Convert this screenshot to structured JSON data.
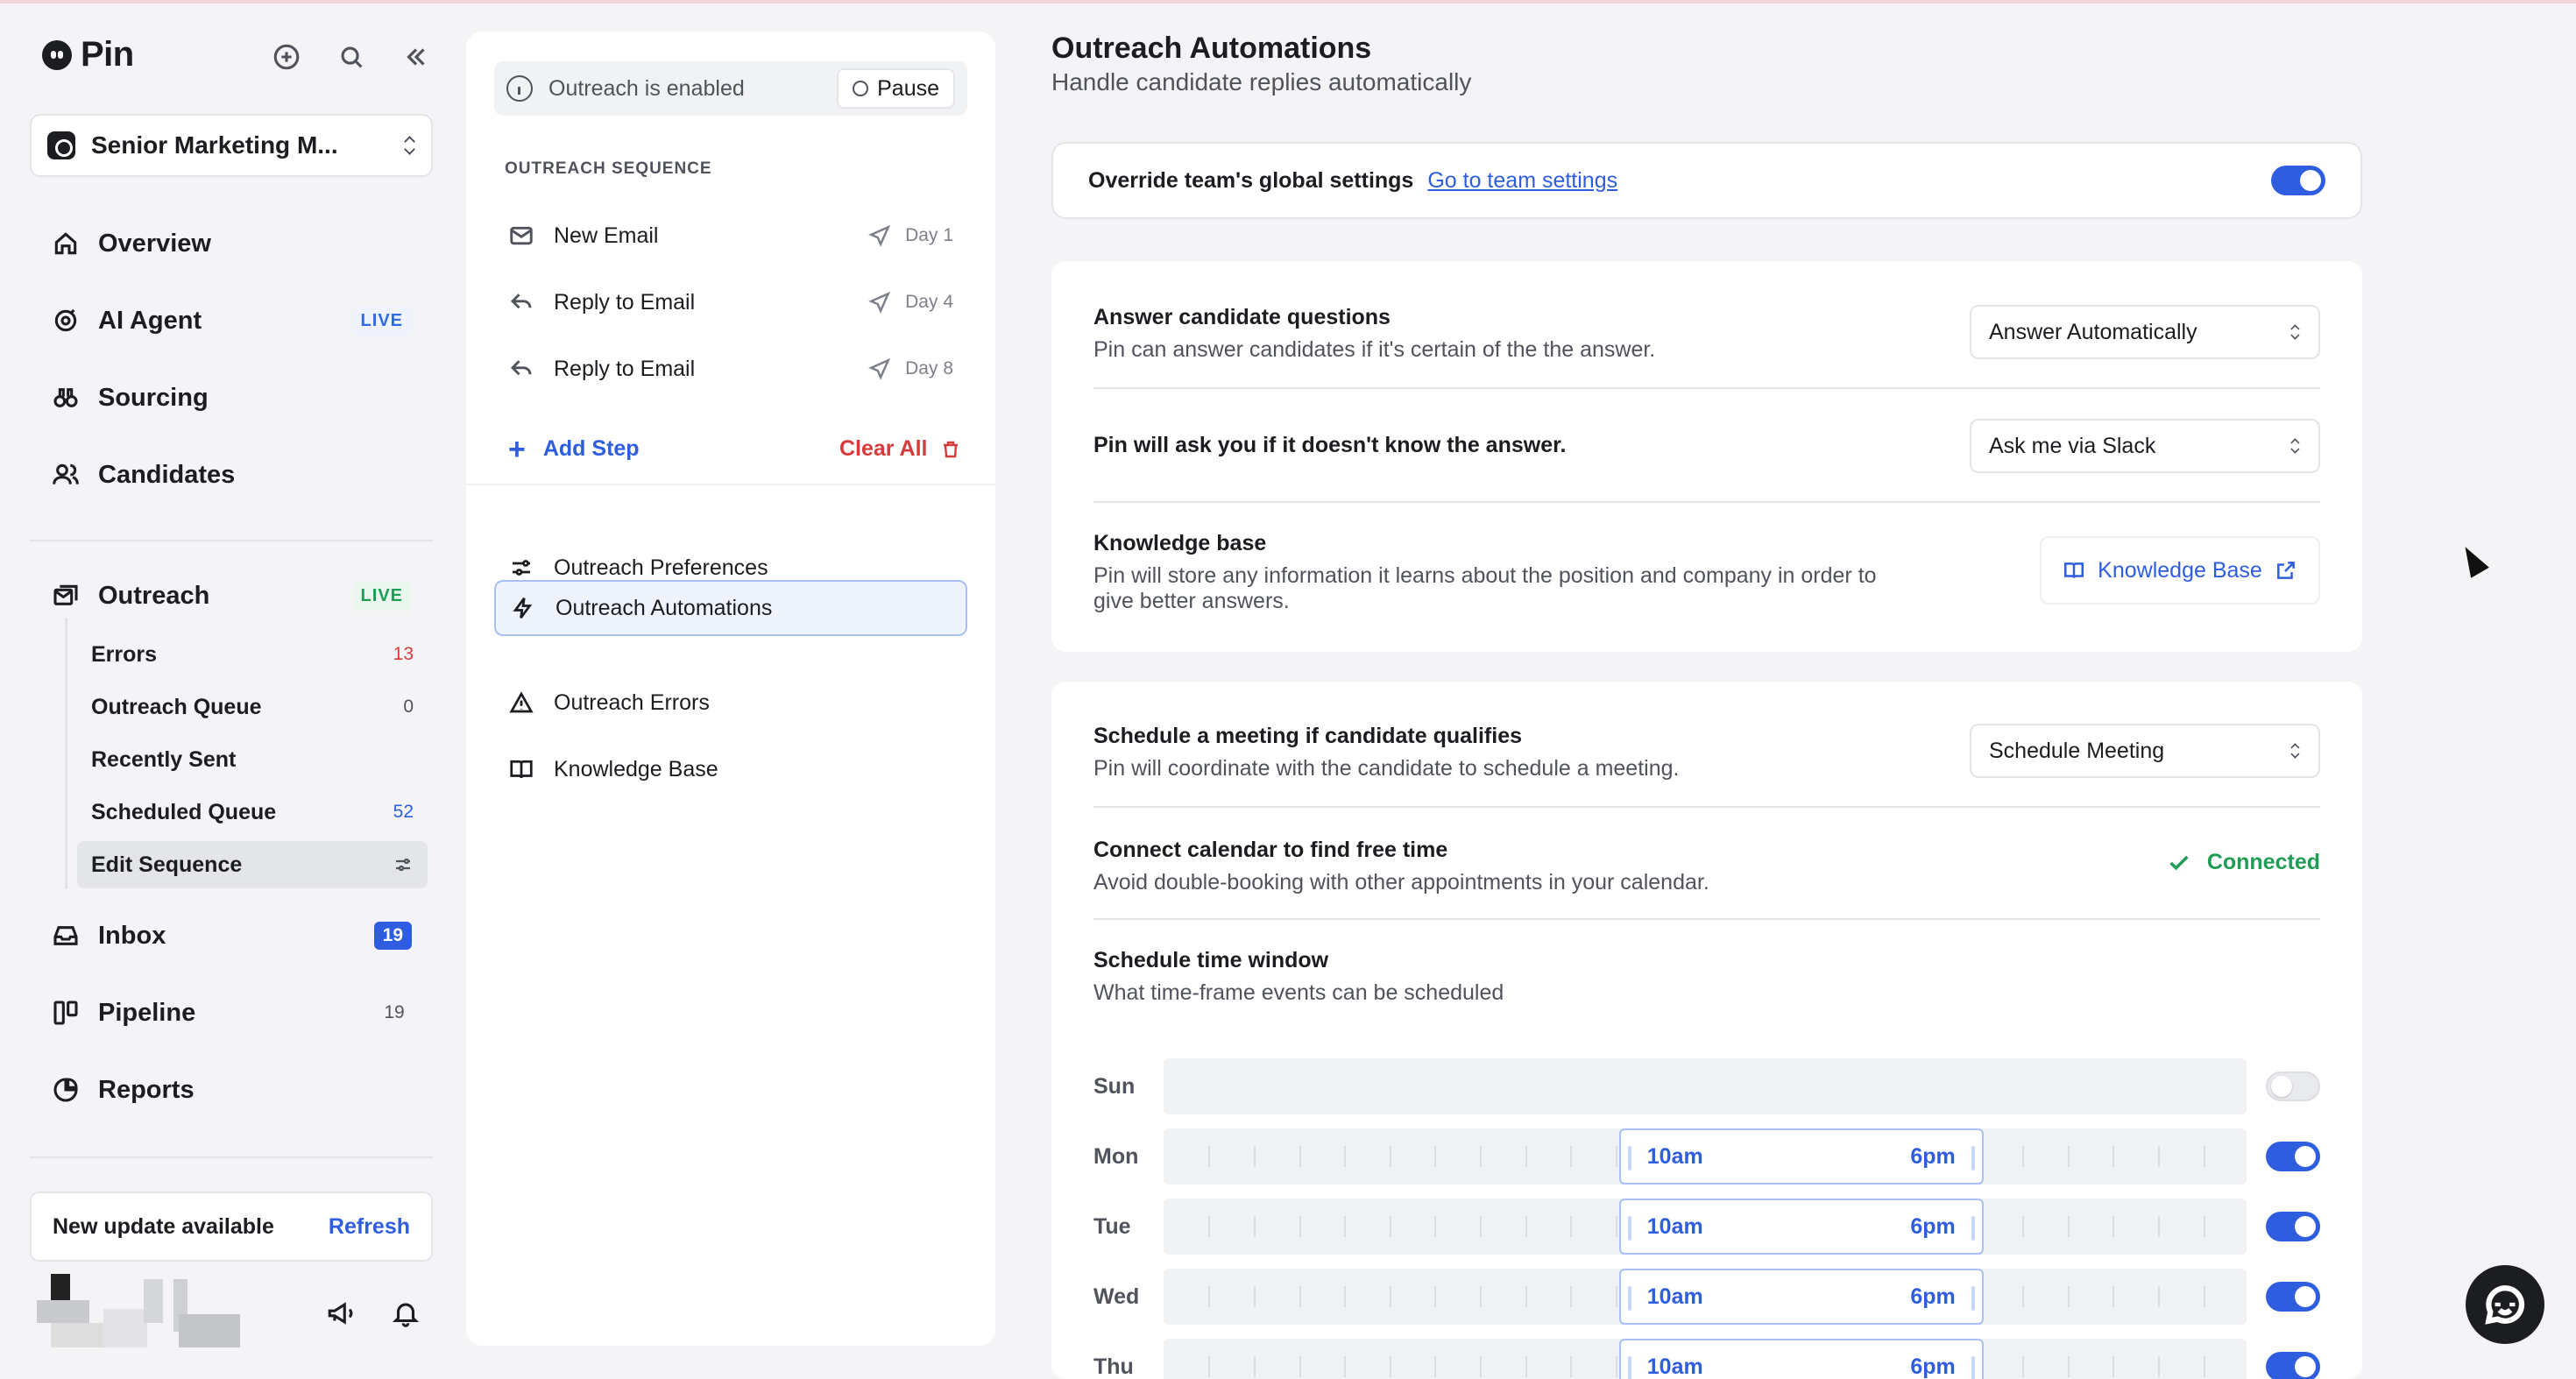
{
  "app": {
    "name": "Pin"
  },
  "sidebar": {
    "job_title": "Senior Marketing M...",
    "nav": [
      {
        "label": "Overview",
        "icon": "home-icon"
      },
      {
        "label": "AI Agent",
        "icon": "ai-agent-icon",
        "badge": "LIVE"
      },
      {
        "label": "Sourcing",
        "icon": "binoculars-icon"
      },
      {
        "label": "Candidates",
        "icon": "users-icon"
      }
    ],
    "outreach": {
      "label": "Outreach",
      "badge": "LIVE",
      "items": [
        {
          "label": "Errors",
          "count": "13"
        },
        {
          "label": "Outreach Queue",
          "count": "0"
        },
        {
          "label": "Recently Sent",
          "count": ""
        },
        {
          "label": "Scheduled Queue",
          "count": "52"
        },
        {
          "label": "Edit Sequence",
          "count": ""
        }
      ]
    },
    "nav_bottom": [
      {
        "label": "Inbox",
        "count": "19"
      },
      {
        "label": "Pipeline",
        "count": "19"
      },
      {
        "label": "Reports",
        "count": ""
      }
    ],
    "update": {
      "message": "New update available",
      "action": "Refresh"
    }
  },
  "middle": {
    "status_text": "Outreach is enabled",
    "pause_label": "Pause",
    "sequence_title": "OUTREACH SEQUENCE",
    "steps": [
      {
        "label": "New Email",
        "day": "Day 1"
      },
      {
        "label": "Reply to Email",
        "day": "Day 4"
      },
      {
        "label": "Reply to Email",
        "day": "Day 8"
      }
    ],
    "add_step": "Add Step",
    "clear_all": "Clear All",
    "nav": [
      {
        "label": "Outreach Preferences"
      },
      {
        "label": "Outreach Automations",
        "active": true
      },
      {
        "label": "Outreach Errors"
      },
      {
        "label": "Knowledge Base"
      }
    ]
  },
  "main": {
    "title": "Outreach Automations",
    "subtitle": "Handle candidate replies automatically",
    "override": {
      "label": "Override team's global settings",
      "link": "Go to team settings",
      "enabled": true
    },
    "questions": {
      "answer_title": "Answer candidate questions",
      "answer_desc": "Pin can answer candidates if it's certain of the the answer.",
      "answer_value": "Answer Automatically",
      "ask_title": "Pin will ask you if it doesn't know the answer.",
      "ask_value": "Ask me via Slack",
      "kb_title": "Knowledge base",
      "kb_desc": "Pin will store any information it learns about the position and company in order to give better answers.",
      "kb_button": "Knowledge Base"
    },
    "meeting": {
      "schedule_title": "Schedule a meeting if candidate qualifies",
      "schedule_desc": "Pin will coordinate with the candidate to schedule a meeting.",
      "schedule_value": "Schedule Meeting",
      "calendar_title": "Connect calendar to find free time",
      "calendar_desc": "Avoid double-booking with other appointments in your calendar.",
      "calendar_status": "Connected",
      "window_title": "Schedule time window",
      "window_desc": "What time-frame events can be scheduled",
      "days": [
        {
          "day": "Sun",
          "enabled": false,
          "from": "",
          "to": ""
        },
        {
          "day": "Mon",
          "enabled": true,
          "from": "10am",
          "to": "6pm"
        },
        {
          "day": "Tue",
          "enabled": true,
          "from": "10am",
          "to": "6pm"
        },
        {
          "day": "Wed",
          "enabled": true,
          "from": "10am",
          "to": "6pm"
        },
        {
          "day": "Thu",
          "enabled": true,
          "from": "10am",
          "to": "6pm"
        }
      ]
    }
  },
  "colors": {
    "accent": "#2f5de0",
    "live_green": "#1f9d55",
    "error_red": "#d63b3b"
  }
}
